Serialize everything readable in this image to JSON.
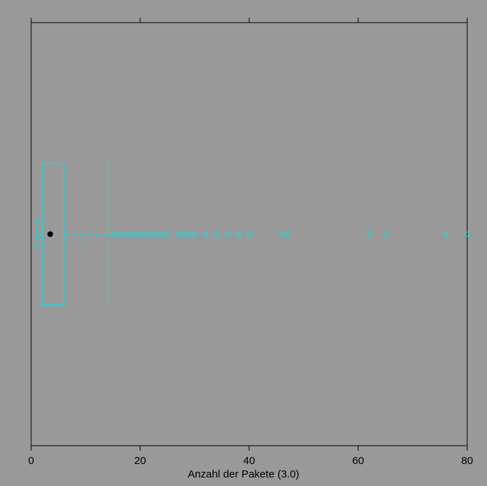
{
  "chart_data": {
    "type": "boxplot",
    "xlabel": "Anzahl der Pakete (3.0)",
    "xlim": [
      0,
      80
    ],
    "x_ticks": [
      0,
      20,
      40,
      60,
      80
    ],
    "orientation": "horizontal",
    "box": {
      "q1": 2,
      "median": 3.5,
      "q3": 6,
      "whisker_low": 1,
      "whisker_high": 14
    },
    "outliers": [
      15,
      16,
      17,
      18,
      19,
      20,
      21,
      22,
      23,
      24,
      25,
      27,
      28,
      29,
      30,
      32,
      34,
      36,
      38,
      40,
      46,
      47,
      62,
      65,
      76,
      80
    ],
    "colors": {
      "box_stroke": "#00E5E5",
      "outlier": "#00E5E5",
      "median_dot": "#000000"
    }
  }
}
